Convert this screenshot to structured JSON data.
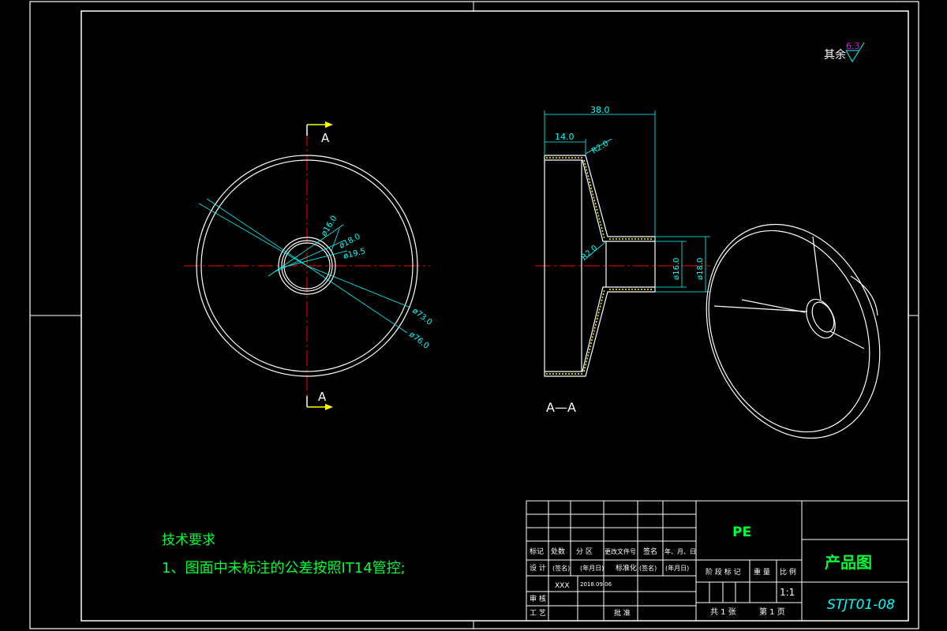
{
  "roughness": {
    "label": "其余",
    "value": "6.3"
  },
  "section_label_top": "A",
  "section_label_bottom": "A",
  "section_title": "A—A",
  "front_view_dims": {
    "d1": "ø16.0",
    "d2": "ø18.0",
    "d3": "ø19.5",
    "d4": "ø73.0",
    "d5": "ø76.0"
  },
  "section_dims": {
    "length": "38.0",
    "flange": "14.0",
    "radius1": "R2.0",
    "radius2": "R2.0",
    "bore": "ø16.0",
    "outer": "ø18.0"
  },
  "tech_req": {
    "title": "技术要求",
    "line1": "1、图面中未标注的公差按照IT14管控;"
  },
  "title_block": {
    "material": "PE",
    "drawing_name": "产品图",
    "drawing_no": "STJT01-08",
    "h_mark": "标记",
    "h_count": "处数",
    "h_zone": "分 区",
    "h_doc": "更改文件号",
    "h_sign": "签名",
    "h_date": "年、月、日",
    "r_design": "设 计",
    "r_sign1": "(签名)",
    "r_date1": "(年月日)",
    "r_std": "标准化",
    "r_sign2": "(签名)",
    "r_date2": "(年月日)",
    "designer": "XXX",
    "design_date": "2018.09.06",
    "r_review": "审 核",
    "r_process": "工 艺",
    "r_approve": "批 准",
    "stage": "阶 段 标 记",
    "weight": "重 量",
    "scale_label": "比 例",
    "scale": "1:1",
    "total_sheets": "共 1 张",
    "sheet_no": "第 1 页"
  }
}
